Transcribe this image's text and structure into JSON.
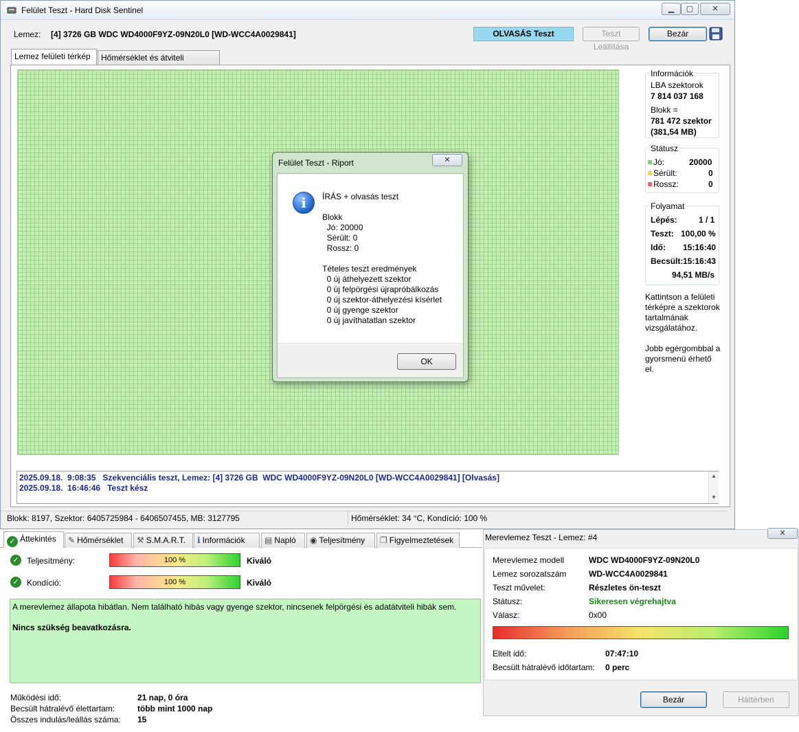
{
  "main": {
    "title": "Felület Teszt - Hard Disk Sentinel",
    "minimize": "▁",
    "maximize": "▢",
    "close": "✕",
    "drive_label": "Lemez:",
    "drive_value": "[4] 3726 GB  WDC WD4000F9YZ-09N20L0 [WD-WCC4A0029841]",
    "test_status": "OLVASÁS Teszt",
    "stop_button": "Teszt Leállítása",
    "close_button": "Bezár",
    "save_icon": "floppy-icon",
    "tabs": [
      "Lemez felületi térkép",
      "Hőmérséklet és átviteli sebesség"
    ]
  },
  "info": {
    "title": "Információk",
    "lba_label": "LBA szektorok",
    "lba_value": "7 814 037 168",
    "block_label": "Blokk =",
    "block_value1": "781 472 szektor",
    "block_value2": "(381,54 MB)"
  },
  "status_panel": {
    "title": "Státusz",
    "good_label": "Jó:",
    "good_value": "20000",
    "damaged_label": "Sérült:",
    "damaged_value": "0",
    "bad_label": "Rossz:",
    "bad_value": "0",
    "good_color": "#7ed36b",
    "damaged_color": "#e8d84a",
    "bad_color": "#e86b6b"
  },
  "progress": {
    "title": "Folyamat",
    "step_label": "Lépés:",
    "step_value": "1 / 1",
    "test_label": "Teszt:",
    "test_value": "100,00 %",
    "time_label": "Idő:",
    "time_value": "15:16:40",
    "est_label": "Becsült:",
    "est_value": "15:16:43",
    "speed": "94,51 MB/s"
  },
  "help": {
    "line1": "Kattintson a felületi",
    "line2": "térképre a szektorok",
    "line3": "tartalmának",
    "line4": "vizsgálatához.",
    "line5": "Jobb egérgombbal a",
    "line6": "gyorsmenü érhető",
    "line7": "el."
  },
  "log": {
    "line1": "2025.09.18.  9:08:35   Szekvenciális teszt, Lemez: [4] 3726 GB  WDC WD4000F9YZ-09N20L0 [WD-WCC4A0029841] [Olvasás]",
    "line2": "2025.09.18.  16:46:46   Teszt kész"
  },
  "statusbar": {
    "left": "Blokk: 8197, Szektor: 6405725984 - 6406507455, MB: 3127795",
    "right": "Hőmérséklet: 34  °C, Kondíció: 100 %"
  },
  "dialog": {
    "title": "Felület Teszt - Riport",
    "close": "✕",
    "icon": "info-icon",
    "heading": "ÍRÁS + olvasás teszt",
    "block": "Blokk",
    "good": "  Jó: 20000",
    "damaged": "  Sérült: 0",
    "bad": "  Rossz: 0",
    "batch": "Tételes teszt eredmények",
    "r1": "  0 új áthelyezett szektor",
    "r2": "  0 új felpörgési újrapróbálkozás",
    "r3": "  0 új szektor-áthelyezési kísérlet",
    "r4": "  0 új gyenge szektor",
    "r5": "  0 új javíthatatlan szektor",
    "ok": "OK"
  },
  "overview": {
    "tabs": [
      "Áttekintés",
      "Hőmérséklet",
      "S.M.A.R.T.",
      "Információk",
      "Napló",
      "Teljesítmény",
      "Figyelmeztetések"
    ],
    "perf_label": "Teljesítmény:",
    "perf_value": "100 %",
    "perf_rating": "Kiváló",
    "cond_label": "Kondíció:",
    "cond_value": "100 %",
    "cond_rating": "Kiváló",
    "perf_fraction": 1.0,
    "cond_fraction": 1.0,
    "message": "A merevlemez állapota hibátlan. Nem található hibás vagy gyenge szektor, nincsenek felpörgési és adatátviteli hibák sem.",
    "message_bold": "Nincs szükség beavatkozásra.",
    "uptime_label": "Működési idő:",
    "uptime_value": "21 nap, 0 óra",
    "life_label": "Becsült hátralévő élettartam:",
    "life_value": "több mint 1000 nap",
    "starts_label": "Összes indulás/leállás száma:",
    "starts_value": "15"
  },
  "smart_dialog": {
    "title": "Merevlemez Teszt - Lemez: #4",
    "close": "✕",
    "model_label": "Merevlemez modell",
    "model_value": "WDC WD4000F9YZ-09N20L0",
    "serial_label": "Lemez sorozatszám",
    "serial_value": "WD-WCC4A0029841",
    "op_label": "Teszt művelet:",
    "op_value": "Részletes ön-teszt",
    "status_label": "Státusz:",
    "status_value": "Sikeresen végrehajtva",
    "status_color": "#1a8a1a",
    "answer_label": "Válasz:",
    "answer_value": "0x00",
    "progress_fraction": 1.0,
    "elapsed_label": "Eltelt idő:",
    "elapsed_value": "07:47:10",
    "remaining_label": "Becsült hátralévő időtartam:",
    "remaining_value": "0 perc",
    "close_button": "Bezár",
    "background_button": "Háttérben"
  }
}
